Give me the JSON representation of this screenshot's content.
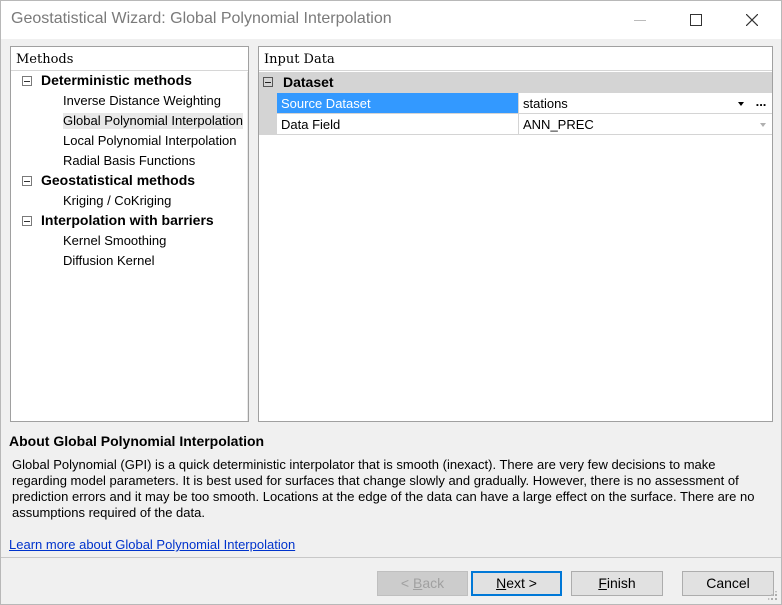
{
  "window": {
    "title": "Geostatistical Wizard: Global Polynomial Interpolation"
  },
  "methods": {
    "header": "Methods",
    "groups": [
      {
        "label": "Deterministic methods",
        "items": [
          {
            "label": "Inverse Distance Weighting"
          },
          {
            "label": "Global Polynomial Interpolation"
          },
          {
            "label": "Local Polynomial Interpolation"
          },
          {
            "label": "Radial Basis Functions"
          }
        ]
      },
      {
        "label": "Geostatistical methods",
        "items": [
          {
            "label": "Kriging / CoKriging"
          }
        ]
      },
      {
        "label": "Interpolation with barriers",
        "items": [
          {
            "label": "Kernel Smoothing"
          },
          {
            "label": "Diffusion Kernel"
          }
        ]
      }
    ],
    "selected": "Global Polynomial Interpolation"
  },
  "input": {
    "header": "Input Data",
    "section": "Dataset",
    "rows": [
      {
        "name": "Source Dataset",
        "value": "stations",
        "ellipsis": "..."
      },
      {
        "name": "Data Field",
        "value": "ANN_PREC"
      }
    ]
  },
  "about": {
    "title": "About Global Polynomial Interpolation",
    "text": "Global Polynomial (GPI) is a quick deterministic interpolator that is smooth (inexact). There are very few decisions to make regarding model parameters. It is best used for surfaces that change slowly and gradually. However, there is no assessment of prediction errors and it may be too smooth. Locations at the edge of the data can have a large effect on the surface. There are no assumptions required of the data.",
    "link": "Learn more about Global Polynomial Interpolation"
  },
  "buttons": {
    "back_prefix": "< ",
    "back_key": "B",
    "back_rest": "ack",
    "next_key": "N",
    "next_rest": "ext >",
    "finish_key": "F",
    "finish_rest": "inish",
    "cancel": "Cancel"
  },
  "colors": {
    "selection": "#3399ff",
    "link": "#0033cc",
    "default_button_border": "#0078d7"
  }
}
